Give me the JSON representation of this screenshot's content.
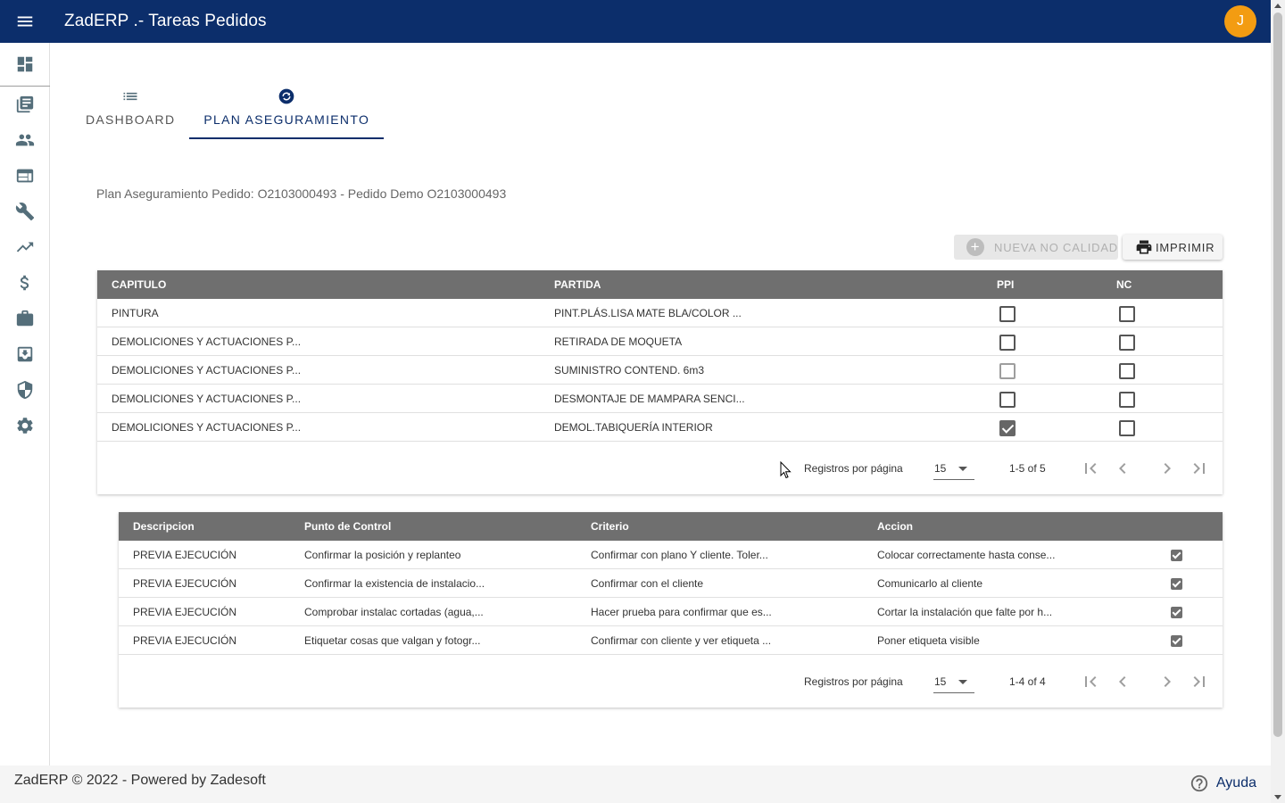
{
  "app": {
    "title": "ZadERP .- Tareas Pedidos",
    "avatar_initial": "J"
  },
  "sidebar": {
    "icons": [
      "dashboard-icon",
      "library-books-icon",
      "people-icon",
      "web-icon",
      "wrench-icon",
      "trending-up-icon",
      "dollar-icon",
      "briefcase-icon",
      "archive-icon",
      "security-shield-icon",
      "settings-gear-icon"
    ]
  },
  "tabs": [
    {
      "label": "DASHBOARD",
      "icon": "list-icon",
      "active": false
    },
    {
      "label": "PLAN ASEGURAMIENTO",
      "icon": "refresh-circle-icon",
      "active": true
    }
  ],
  "page": {
    "subtitle": "Plan Aseguramiento Pedido: O2103000493 - Pedido Demo O2103000493",
    "new_nc_label": "NUEVA NO CALIDAD",
    "print_label": "IMPRIMIR"
  },
  "table1": {
    "headers": {
      "capitulo": "CAPITULO",
      "partida": "PARTIDA",
      "ppi": "PPI",
      "nc": "NC"
    },
    "rows": [
      {
        "capitulo": "PINTURA",
        "partida": "PINT.PLÁS.LISA MATE BLA/COLOR ...",
        "ppi": false,
        "nc": false
      },
      {
        "capitulo": "DEMOLICIONES Y ACTUACIONES P...",
        "partida": "RETIRADA DE MOQUETA",
        "ppi": false,
        "nc": false
      },
      {
        "capitulo": "DEMOLICIONES Y ACTUACIONES P...",
        "partida": "SUMINISTRO CONTEND. 6m3",
        "ppi": false,
        "nc": false
      },
      {
        "capitulo": "DEMOLICIONES Y ACTUACIONES P...",
        "partida": "DESMONTAJE DE MAMPARA SENCI...",
        "ppi": false,
        "nc": false
      },
      {
        "capitulo": "DEMOLICIONES Y ACTUACIONES P...",
        "partida": "DEMOL.TABIQUERÍA INTERIOR",
        "ppi": true,
        "nc": false
      }
    ],
    "pager": {
      "label": "Registros por página",
      "per_page": "15",
      "range": "1-5 of 5"
    }
  },
  "table2": {
    "headers": {
      "descripcion": "Descripcion",
      "punto": "Punto de Control",
      "criterio": "Criterio",
      "accion": "Accion"
    },
    "rows": [
      {
        "descripcion": "PREVIA EJECUCIÓN",
        "punto": "Confirmar la posición y replanteo",
        "criterio": "Confirmar con plano Y cliente. Toler...",
        "accion": "Colocar correctamente hasta conse...",
        "checked": true
      },
      {
        "descripcion": "PREVIA EJECUCIÓN",
        "punto": "Confirmar la existencia de instalacio...",
        "criterio": "Confirmar con el cliente",
        "accion": "Comunicarlo al cliente",
        "checked": true
      },
      {
        "descripcion": "PREVIA EJECUCIÓN",
        "punto": "Comprobar instalac cortadas (agua,...",
        "criterio": "Hacer prueba para confirmar que es...",
        "accion": "Cortar la instalación que falte por h...",
        "checked": true
      },
      {
        "descripcion": "PREVIA EJECUCIÓN",
        "punto": "Etiquetar cosas que valgan y fotogr...",
        "criterio": "Confirmar con cliente y ver etiqueta ...",
        "accion": "Poner etiqueta visible",
        "checked": true
      }
    ],
    "pager": {
      "label": "Registros por página",
      "per_page": "15",
      "range": "1-4 of 4"
    }
  },
  "footer": {
    "text": "ZadERP © 2022 - Powered by Zadesoft",
    "help_label": "Ayuda"
  },
  "colors": {
    "primary": "#0c2e6b",
    "avatar": "#f39c12",
    "table_header": "#6f6f6f"
  }
}
